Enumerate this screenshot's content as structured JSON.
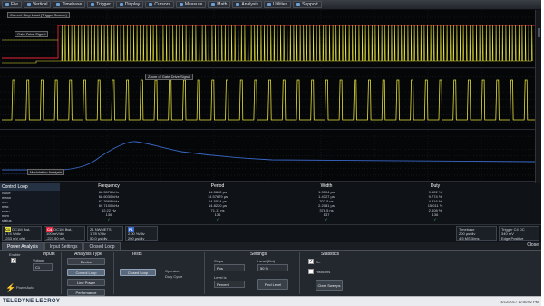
{
  "menu": [
    {
      "label": "File",
      "icon": "file-icon"
    },
    {
      "label": "Vertical",
      "icon": "vertical-icon"
    },
    {
      "label": "Timebase",
      "icon": "timebase-icon"
    },
    {
      "label": "Trigger",
      "icon": "trigger-icon"
    },
    {
      "label": "Display",
      "icon": "display-icon"
    },
    {
      "label": "Cursors",
      "icon": "cursors-icon"
    },
    {
      "label": "Measure",
      "icon": "measure-icon"
    },
    {
      "label": "Math",
      "icon": "math-icon"
    },
    {
      "label": "Analysis",
      "icon": "analysis-icon"
    },
    {
      "label": "Utilities",
      "icon": "utilities-icon"
    },
    {
      "label": "Support",
      "icon": "support-icon"
    }
  ],
  "panes": {
    "top_labels": [
      "Current Step Load (Trigger Source)",
      "Gate Drive Signal"
    ],
    "zoom_label": "Zoom of Gate Drive Signal",
    "track_label": "Modulation Analysis"
  },
  "colors": {
    "c1": "#e6e23a",
    "c4": "#e8243a",
    "track": "#3a68c8"
  },
  "measure": {
    "title": "Control Loop",
    "rows": [
      "value",
      "mean",
      "min",
      "max",
      "sdev",
      "num",
      "status"
    ],
    "columns": [
      {
        "head": "Frequency",
        "cells": [
          "68.5576 kHz",
          "68.6030 kHz",
          "63.3968 kHz",
          "69.7100 kHz",
          "52.22 Hz",
          "136"
        ]
      },
      {
        "head": "Period",
        "cells": [
          "14.5862 µs",
          "14.57679 µs",
          "14.5524 µs",
          "14.8220 µs",
          "71.11 ns",
          "136"
        ]
      },
      {
        "head": "Width",
        "cells": [
          "1.3504 µs",
          "1.4327 µs",
          "702.5 ns",
          "2.2081 µs",
          "378.5 ns",
          "137"
        ]
      },
      {
        "head": "Duty",
        "cells": [
          "9.622 %",
          "9.774 %",
          "4.816 %",
          "15.011 %",
          "2.608 %",
          "136"
        ]
      }
    ]
  },
  "descriptors": {
    "c1": {
      "tag": "C1",
      "lines": [
        "DC1M BwL",
        "1.74 V/div",
        "-233 mV ofst"
      ]
    },
    "c4": {
      "tag": "C4",
      "lines": [
        "DC1M BwL",
        "100 mV/div",
        "-223.50 mA"
      ]
    },
    "zoom": {
      "tag": "Z1",
      "lines": [
        "Z1 NWMETS",
        "1.78 V/div",
        "50.0 µs/div"
      ]
    },
    "track": {
      "tag": "F1",
      "lines": [
        "",
        "2.00 %/div",
        "200 µs/div"
      ]
    },
    "timebase": {
      "head": "Timebase",
      "lines": [
        "200 µs/div",
        "4.5 MS 3/ms"
      ]
    },
    "trigger": {
      "head": "Trigger",
      "lines": [
        "C4 DC",
        "340 mV",
        "Edge Positive"
      ]
    }
  },
  "tabs": [
    "Power Analysis",
    "Input Settings",
    "Closed Loop"
  ],
  "close_label": "Close",
  "dialog": {
    "enable_label": "Enable",
    "inputs": {
      "title": "Inputs",
      "voltage_label": "Voltage",
      "voltage_value": "C1"
    },
    "analysis_type": {
      "title": "Analysis Type",
      "options": [
        "Device",
        "Control Loop",
        "Line Power",
        "Performance"
      ],
      "selected": "Control Loop"
    },
    "tests": {
      "title": "Tests",
      "selected": "Closed Loop"
    },
    "operator_label": "Operator",
    "operator_value": "Duty Cycle",
    "settings": {
      "title": "Settings",
      "slope_label": "Slope",
      "slope_value": "Pos",
      "level_label": "Level (Pct)",
      "level_value": "50 %",
      "level_is_label": "Level is",
      "level_is_value": "Percent",
      "find_level": "Find Level"
    },
    "statistics": {
      "title": "Statistics",
      "on_label": "On",
      "histicons_label": "Histicons",
      "clear_sweeps": "Clear Sweeps"
    },
    "power_auto": "PowerAuto"
  },
  "footer": {
    "brand": "TELEDYNE LECROY",
    "timestamp": "4/12/2017 12:50:02 PM"
  }
}
